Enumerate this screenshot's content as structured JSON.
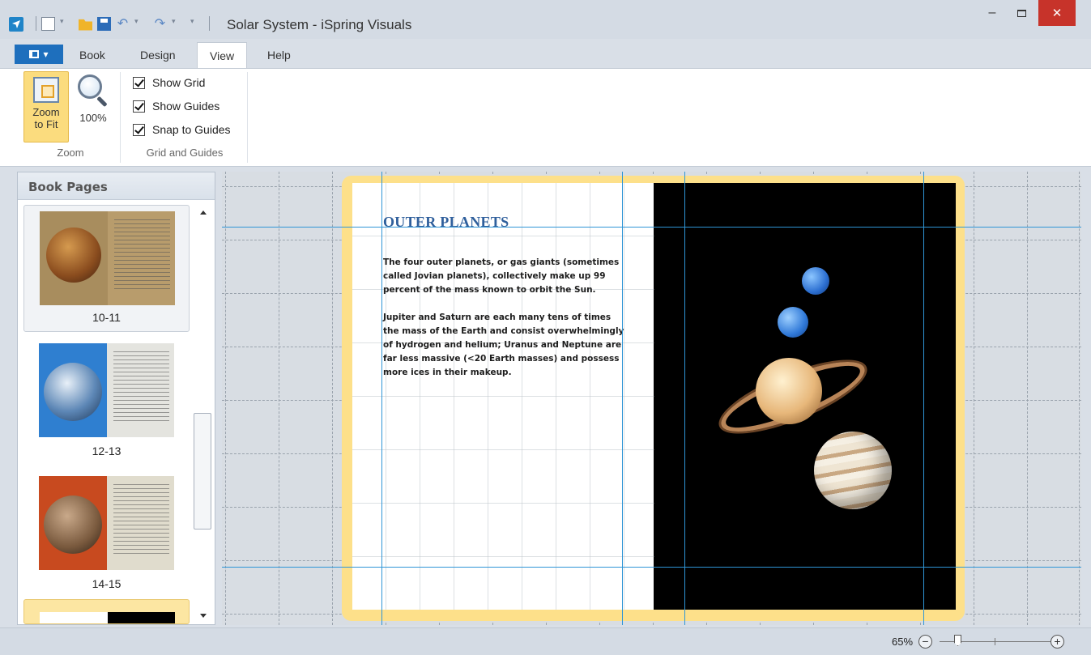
{
  "window": {
    "title": "Solar System - iSpring Visuals",
    "minimize": "–",
    "close": "✕"
  },
  "quick_access": {
    "icons": [
      "app-icon",
      "new-icon",
      "open-icon",
      "save-icon",
      "undo-icon",
      "redo-icon",
      "customize-icon"
    ]
  },
  "ribbon": {
    "tabs": [
      {
        "label": "Book"
      },
      {
        "label": "Design"
      },
      {
        "label": "View",
        "active": true
      },
      {
        "label": "Help"
      }
    ],
    "zoom_group": {
      "label": "Zoom",
      "zoom_to_fit_line1": "Zoom",
      "zoom_to_fit_line2": "to Fit",
      "zoom_100": "100%"
    },
    "grid_group": {
      "label": "Grid and Guides",
      "options": [
        {
          "label": "Show Grid",
          "checked": true
        },
        {
          "label": "Show Guides",
          "checked": true
        },
        {
          "label": "Snap to Guides",
          "checked": true
        }
      ]
    }
  },
  "book_pages": {
    "title": "Book Pages",
    "items": [
      {
        "label": "10-11",
        "state": "selected"
      },
      {
        "label": "12-13",
        "state": "normal"
      },
      {
        "label": "14-15",
        "state": "normal"
      },
      {
        "label": "",
        "state": "highlight"
      }
    ]
  },
  "page": {
    "heading": "OUTER PLANETS",
    "paragraphs": [
      "The four outer planets, or gas giants (sometimes called Jovian planets), collectively make up 99 percent of the mass known to orbit the Sun.",
      "Jupiter and Saturn are each many tens of times the mass of the Earth and consist overwhelmingly of hydrogen and helium; Uranus and Neptune are far less massive (<20 Earth masses) and possess more ices in their makeup."
    ]
  },
  "status": {
    "zoom": "65%",
    "zoom_out": "−",
    "zoom_in": "+"
  },
  "colors": {
    "accent": "#1e6fbd",
    "guide": "#2f95d6",
    "book_border": "#fde08a",
    "heading": "#2f5f9c"
  }
}
